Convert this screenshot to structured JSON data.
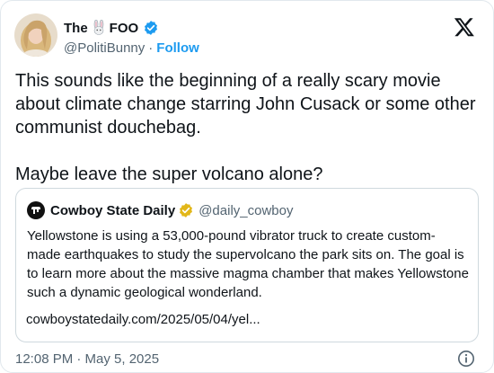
{
  "author": {
    "display_name_prefix": "The",
    "display_name_suffix": "FOO",
    "handle": "@PolitiBunny",
    "separator": "·",
    "follow_label": "Follow"
  },
  "tweet": {
    "text": "This sounds like the beginning of a really scary movie about climate change starring John Cusack or some other communist douchebag.\n\nMaybe leave the super volcano alone?",
    "timestamp": "12:08 PM · May 5, 2025"
  },
  "quoted": {
    "display_name": "Cowboy State Daily",
    "handle": "@daily_cowboy",
    "text": "Yellowstone is using a 53,000-pound vibrator truck to create custom-made earthquakes to study the supervolcano the park sits on. The goal is to learn more about the massive magma chamber that makes Yellowstone such a dynamic geological wonderland.",
    "link": "cowboystatedaily.com/2025/05/04/yel..."
  },
  "colors": {
    "accent": "#1d9bf0",
    "text": "#0f1419",
    "muted": "#536471",
    "border": "#cfd9de",
    "gold": "#e2b719"
  },
  "icons": {
    "avatar": "user-avatar",
    "bunny": "rabbit-emoji-icon",
    "verified": "verified-badge-icon",
    "x_logo": "x-logo-icon",
    "quote_avatar": "cowboy-state-daily-logo",
    "gold_verified": "gold-verified-badge-icon",
    "info": "info-icon"
  }
}
